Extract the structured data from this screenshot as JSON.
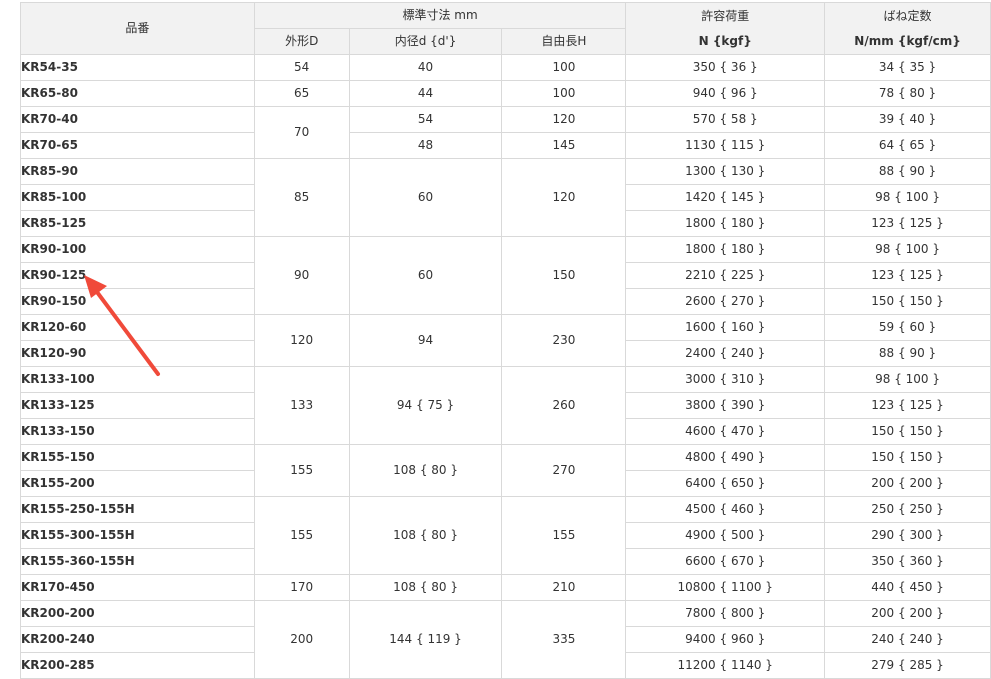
{
  "headers": {
    "part_no": "品番",
    "std_dim": "標準寸法 mm",
    "outer": "外形D",
    "inner": "内径d {d'}",
    "free_len": "自由長H",
    "load_line1": "許容荷重",
    "load_line2": "N {kgf}",
    "rate_line1": "ばね定数",
    "rate_line2": "N/mm {kgf/cm}"
  },
  "groups": [
    {
      "D": "54",
      "d": "40",
      "H": "100",
      "rows": [
        {
          "part": "KR54-35",
          "load": "350 { 36 }",
          "rate": "34 { 35 }"
        }
      ]
    },
    {
      "D": "65",
      "d": "44",
      "H": "100",
      "rows": [
        {
          "part": "KR65-80",
          "load": "940 { 96 }",
          "rate": "78 { 80 }"
        }
      ]
    },
    {
      "D": "70",
      "rows": [
        {
          "part": "KR70-40",
          "d": "54",
          "H": "120",
          "load": "570 { 58 }",
          "rate": "39 { 40 }"
        },
        {
          "part": "KR70-65",
          "d": "48",
          "H": "145",
          "load": "1130 { 115 }",
          "rate": "64 { 65 }"
        }
      ]
    },
    {
      "D": "85",
      "d": "60",
      "H": "120",
      "rows": [
        {
          "part": "KR85-90",
          "load": "1300 { 130 }",
          "rate": "88 { 90 }"
        },
        {
          "part": "KR85-100",
          "load": "1420 { 145 }",
          "rate": "98 { 100 }"
        },
        {
          "part": "KR85-125",
          "load": "1800 { 180 }",
          "rate": "123 { 125 }"
        }
      ]
    },
    {
      "D": "90",
      "d": "60",
      "H": "150",
      "rows": [
        {
          "part": "KR90-100",
          "load": "1800 { 180 }",
          "rate": "98 { 100 }"
        },
        {
          "part": "KR90-125",
          "load": "2210 { 225 }",
          "rate": "123 { 125 }"
        },
        {
          "part": "KR90-150",
          "load": "2600 { 270 }",
          "rate": "150 { 150 }"
        }
      ]
    },
    {
      "D": "120",
      "d": "94",
      "H": "230",
      "rows": [
        {
          "part": "KR120-60",
          "load": "1600 { 160 }",
          "rate": "59 { 60 }"
        },
        {
          "part": "KR120-90",
          "load": "2400 { 240 }",
          "rate": "88 { 90 }"
        }
      ]
    },
    {
      "D": "133",
      "d": "94 { 75 }",
      "H": "260",
      "rows": [
        {
          "part": "KR133-100",
          "load": "3000 { 310 }",
          "rate": "98 { 100 }"
        },
        {
          "part": "KR133-125",
          "load": "3800 { 390 }",
          "rate": "123 { 125 }"
        },
        {
          "part": "KR133-150",
          "load": "4600 { 470 }",
          "rate": "150 { 150 }"
        }
      ]
    },
    {
      "D": "155",
      "d": "108 { 80 }",
      "H": "270",
      "rows": [
        {
          "part": "KR155-150",
          "load": "4800 { 490 }",
          "rate": "150 { 150 }"
        },
        {
          "part": "KR155-200",
          "load": "6400 { 650 }",
          "rate": "200 { 200 }"
        }
      ]
    },
    {
      "D": "155",
      "d": "108 { 80 }",
      "H": "155",
      "rows": [
        {
          "part": "KR155-250-155H",
          "load": "4500 { 460 }",
          "rate": "250 { 250 }"
        },
        {
          "part": "KR155-300-155H",
          "load": "4900 { 500 }",
          "rate": "290 { 300 }"
        },
        {
          "part": "KR155-360-155H",
          "load": "6600 { 670 }",
          "rate": "350 { 360 }"
        }
      ]
    },
    {
      "D": "170",
      "d": "108 { 80 }",
      "H": "210",
      "rows": [
        {
          "part": "KR170-450",
          "load": "10800 { 1100 }",
          "rate": "440 { 450 }"
        }
      ]
    },
    {
      "D": "200",
      "d": "144 { 119 }",
      "H": "335",
      "rows": [
        {
          "part": "KR200-200",
          "load": "7800 { 800 }",
          "rate": "200 { 200 }"
        },
        {
          "part": "KR200-240",
          "load": "9400 { 960 }",
          "rate": "240 { 240 }"
        },
        {
          "part": "KR200-285",
          "load": "11200 { 1140 }",
          "rate": "279 { 285 }"
        }
      ]
    }
  ],
  "annotation": {
    "arrow_color": "#f04a3a",
    "points_to": "KR90-125"
  },
  "colors": {
    "header_bg": "#f2f2f2",
    "border": "#d9d9d9"
  }
}
